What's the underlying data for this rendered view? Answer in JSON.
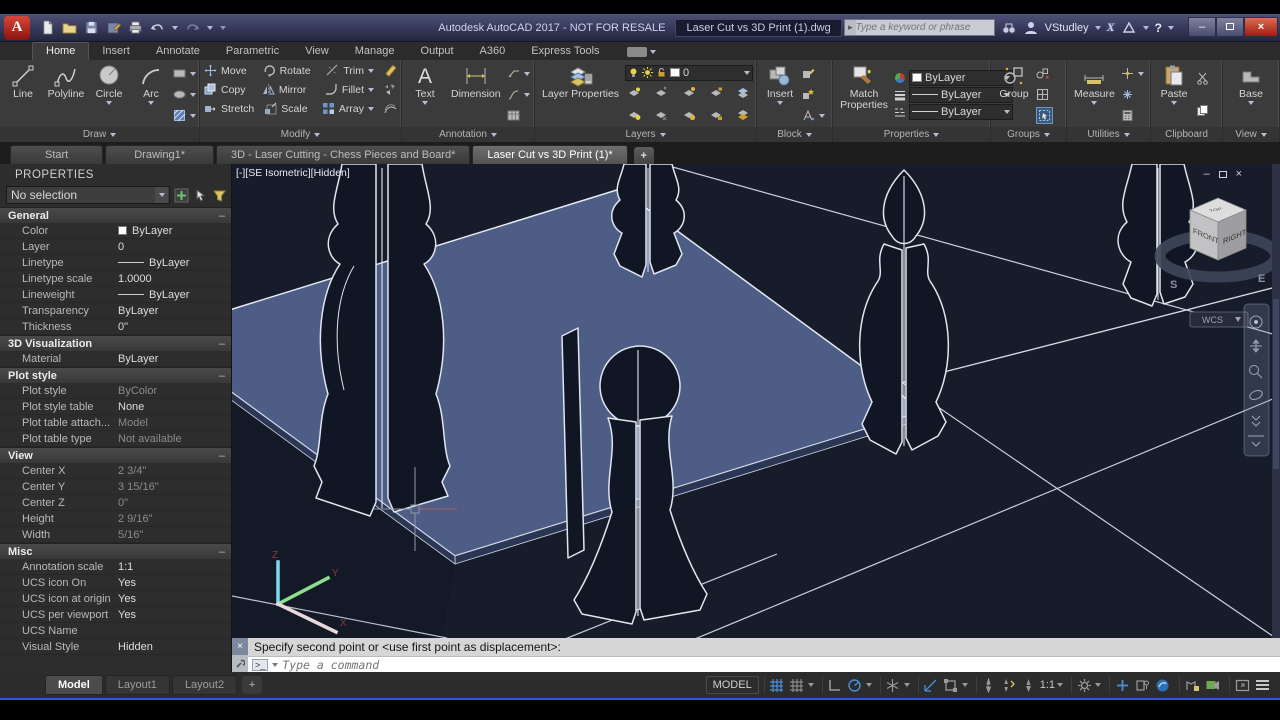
{
  "icons": {
    "close": "×",
    "minus": "–",
    "help": "?",
    "plus": "+",
    "prompt": ">_",
    "collapse": "–",
    "search_arrow": "▸",
    "exchange": "X"
  },
  "titlebar": {
    "logo_letter": "A",
    "app_title": "Autodesk AutoCAD 2017 - NOT FOR RESALE",
    "doc_title": "Laser Cut vs 3D Print (1).dwg",
    "search_placeholder": "Type a keyword or phrase",
    "user_name": "VStudley"
  },
  "ribbon": {
    "tabs": [
      "Home",
      "Insert",
      "Annotate",
      "Parametric",
      "View",
      "Manage",
      "Output",
      "A360",
      "Express Tools"
    ],
    "active_tab": "Home",
    "panels": [
      {
        "label": "Draw",
        "buttons": [
          "Line",
          "Polyline",
          "Circle",
          "Arc"
        ]
      },
      {
        "label": "Modify",
        "buttons": [
          "Move",
          "Rotate",
          "Trim",
          "Copy",
          "Mirror",
          "Fillet",
          "Stretch",
          "Scale",
          "Array"
        ]
      },
      {
        "label": "Annotation",
        "buttons": [
          "Text",
          "Dimension"
        ]
      },
      {
        "label": "Layers",
        "buttons": [
          "Layer Properties"
        ],
        "current_layer": "0"
      },
      {
        "label": "Block",
        "buttons": [
          "Insert"
        ]
      },
      {
        "label": "Properties",
        "buttons": [
          "Match Properties"
        ],
        "color": "ByLayer",
        "lineweight": "ByLayer",
        "linetype": "ByLayer"
      },
      {
        "label": "Groups",
        "buttons": [
          "Group"
        ]
      },
      {
        "label": "Utilities",
        "buttons": [
          "Measure"
        ]
      },
      {
        "label": "Clipboard",
        "buttons": [
          "Paste"
        ]
      },
      {
        "label": "View",
        "buttons": [
          "Base"
        ]
      }
    ]
  },
  "file_tabs": {
    "tabs": [
      "Start",
      "Drawing1*",
      "3D - Laser Cutting - Chess Pieces and Board*",
      "Laser Cut vs 3D Print (1)*"
    ],
    "active": "Laser Cut vs 3D Print (1)*"
  },
  "palette": {
    "title": "PROPERTIES",
    "selection": "No selection",
    "sections": [
      {
        "title": "General",
        "rows": [
          {
            "label": "Color",
            "value": "ByLayer"
          },
          {
            "label": "Layer",
            "value": "0"
          },
          {
            "label": "Linetype",
            "value": "ByLayer"
          },
          {
            "label": "Linetype scale",
            "value": "1.0000"
          },
          {
            "label": "Lineweight",
            "value": "ByLayer"
          },
          {
            "label": "Transparency",
            "value": "ByLayer"
          },
          {
            "label": "Thickness",
            "value": "0\""
          }
        ]
      },
      {
        "title": "3D Visualization",
        "rows": [
          {
            "label": "Material",
            "value": "ByLayer"
          }
        ]
      },
      {
        "title": "Plot style",
        "rows": [
          {
            "label": "Plot style",
            "value": "ByColor",
            "muted": true
          },
          {
            "label": "Plot style table",
            "value": "None"
          },
          {
            "label": "Plot table attach...",
            "value": "Model",
            "muted": true
          },
          {
            "label": "Plot table type",
            "value": "Not available",
            "muted": true
          }
        ]
      },
      {
        "title": "View",
        "rows": [
          {
            "label": "Center X",
            "value": "2 3/4\"",
            "muted": true
          },
          {
            "label": "Center Y",
            "value": "3 15/16\"",
            "muted": true
          },
          {
            "label": "Center Z",
            "value": "0\"",
            "muted": true
          },
          {
            "label": "Height",
            "value": "2 9/16\"",
            "muted": true
          },
          {
            "label": "Width",
            "value": "5/16\"",
            "muted": true
          }
        ]
      },
      {
        "title": "Misc",
        "rows": [
          {
            "label": "Annotation scale",
            "value": "1:1"
          },
          {
            "label": "UCS icon On",
            "value": "Yes"
          },
          {
            "label": "UCS icon at origin",
            "value": "Yes"
          },
          {
            "label": "UCS per viewport",
            "value": "Yes"
          },
          {
            "label": "UCS Name",
            "value": ""
          },
          {
            "label": "Visual Style",
            "value": "Hidden"
          }
        ]
      }
    ]
  },
  "viewport": {
    "label": "[-][SE Isometric][Hidden]",
    "viewcube": {
      "top": "TOP",
      "front": "FRONT",
      "right": "RIGHT",
      "south": "S",
      "east": "E",
      "wcs": "WCS"
    },
    "ucs": {
      "x": "X",
      "y": "Y",
      "z": "Z"
    }
  },
  "command_line": {
    "history": "Specify second point or <use first point as displacement>:",
    "prompt_placeholder": "Type a command"
  },
  "status_bar": {
    "layout_tabs": [
      "Model",
      "Layout1",
      "Layout2"
    ],
    "active_layout": "Model",
    "model_label": "MODEL",
    "annotation_scale": "1:1"
  },
  "colors": {
    "accent_blue": "#4a8fd4",
    "sheet_blue": "#4d5d86",
    "canvas_bg": "#161c2a",
    "close_red": "#b6271a"
  }
}
